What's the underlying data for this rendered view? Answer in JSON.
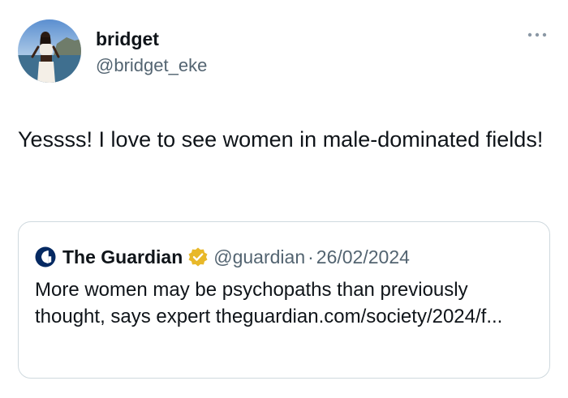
{
  "author": {
    "display_name": "bridget",
    "handle": "@bridget_eke"
  },
  "tweet": {
    "text": "Yessss! I love to see women in male-dominated fields!"
  },
  "quoted": {
    "display_name": "The Guardian",
    "handle": "@guardian",
    "separator": "·",
    "date": "26/02/2024",
    "text": "More women may be psychopaths than previously thought, says expert theguardian.com/society/2024/f..."
  },
  "icons": {
    "more": "more-horizontal-icon",
    "verified": "verified-badge-icon",
    "quoted_avatar": "guardian-logo-icon"
  },
  "colors": {
    "text_primary": "#0f1419",
    "text_secondary": "#536471",
    "border": "#cfd9de",
    "verified_gold": "#e8b829",
    "guardian_blue": "#052962"
  }
}
